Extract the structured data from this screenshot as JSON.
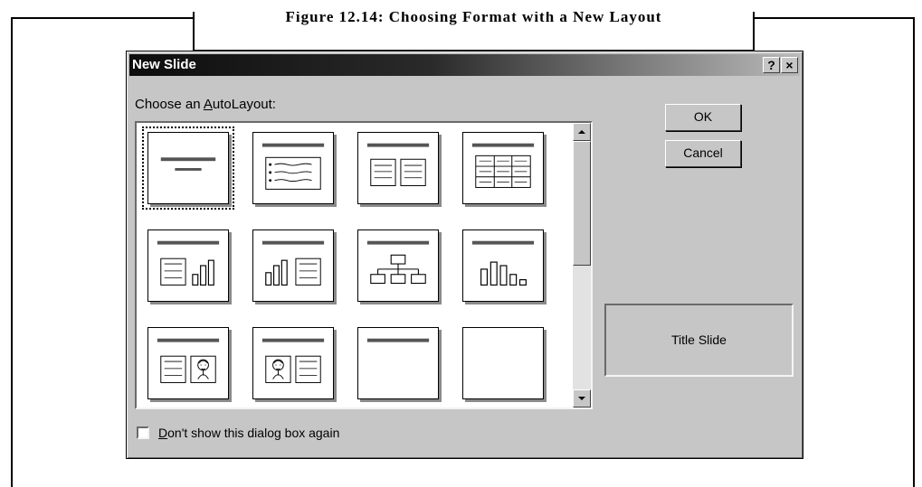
{
  "figure": {
    "caption": "Figure 12.14: Choosing Format with a New Layout"
  },
  "dialog": {
    "title": "New Slide",
    "help_button": "?",
    "close_button": "×",
    "choose_label_prefix": "Choose an ",
    "choose_label_accel": "A",
    "choose_label_suffix": "utoLayout:",
    "ok_label": "OK",
    "cancel_label": "Cancel",
    "preview_label": "Title Slide",
    "checkbox_accel": "D",
    "checkbox_label_rest": "on't show this dialog box again",
    "checkbox_checked": false
  },
  "layouts": [
    {
      "icon": "title-slide-icon",
      "selected": true
    },
    {
      "icon": "bulleted-list-icon"
    },
    {
      "icon": "two-column-text-icon"
    },
    {
      "icon": "table-icon"
    },
    {
      "icon": "text-and-chart-icon"
    },
    {
      "icon": "chart-and-text-icon"
    },
    {
      "icon": "organization-chart-icon"
    },
    {
      "icon": "chart-icon"
    },
    {
      "icon": "text-and-clip-art-icon"
    },
    {
      "icon": "clip-art-and-text-icon"
    },
    {
      "icon": "title-only-icon"
    },
    {
      "icon": "blank-icon"
    }
  ]
}
